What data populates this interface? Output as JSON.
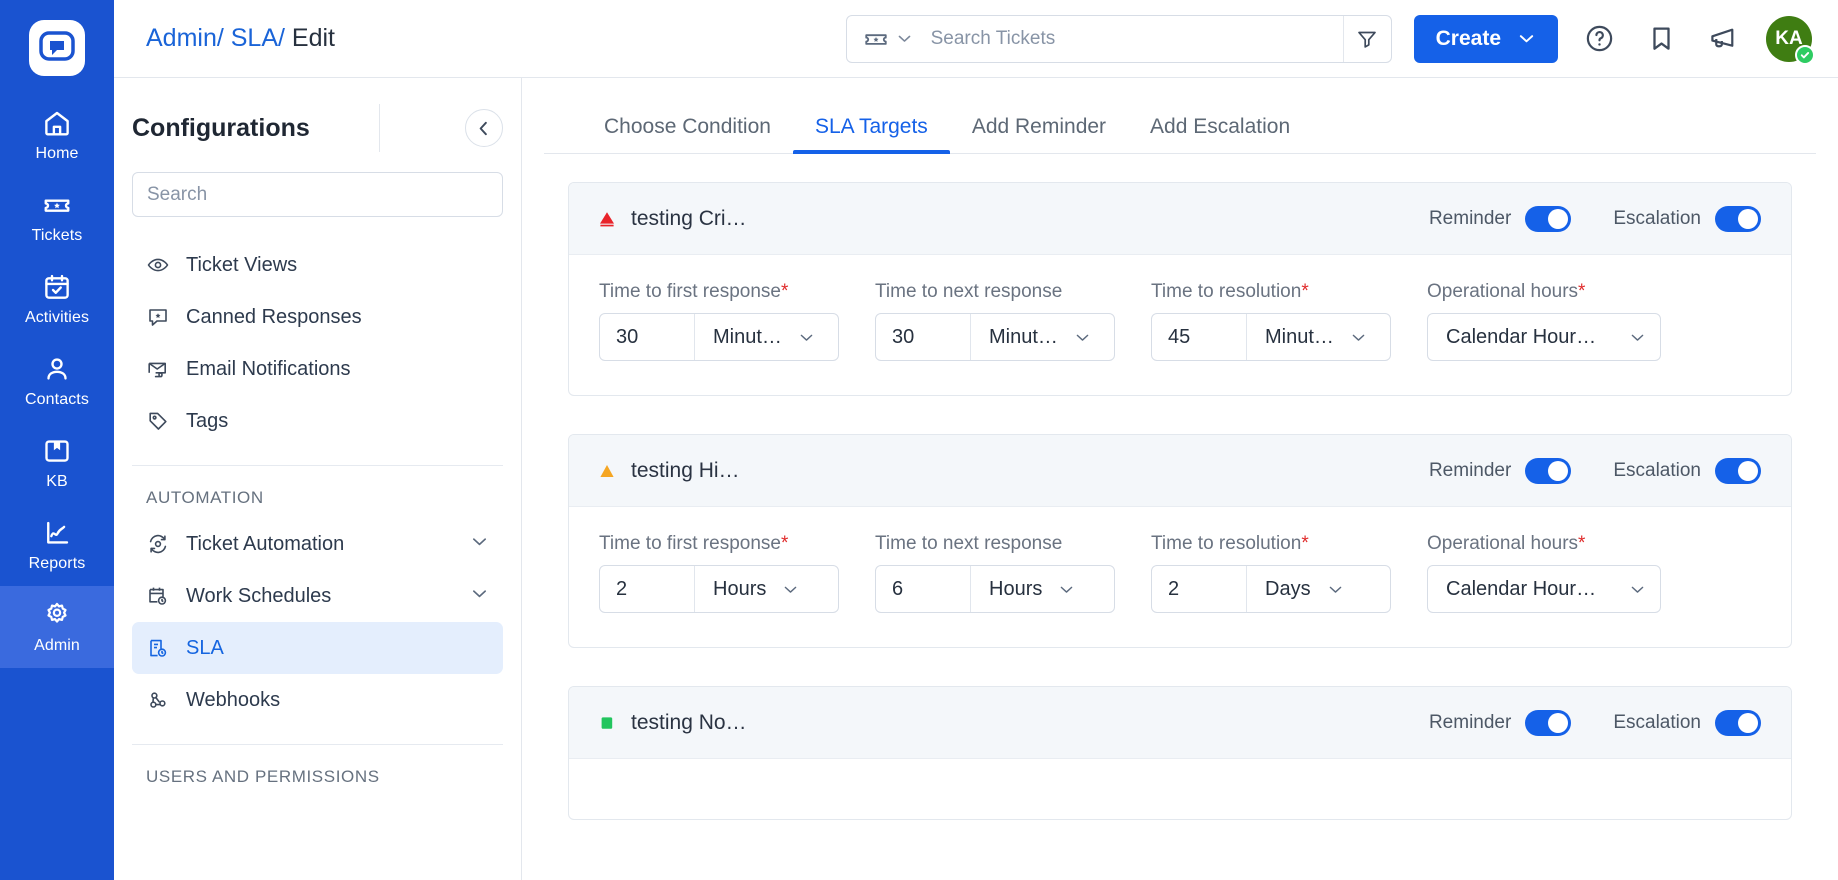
{
  "rail": {
    "logo_name": "app-logo",
    "items": [
      {
        "label": "Home",
        "icon": "home-icon",
        "active": false
      },
      {
        "label": "Tickets",
        "icon": "ticket-icon",
        "active": false
      },
      {
        "label": "Activities",
        "icon": "calendar-check-icon",
        "active": false
      },
      {
        "label": "Contacts",
        "icon": "person-icon",
        "active": false
      },
      {
        "label": "KB",
        "icon": "book-icon",
        "active": false
      },
      {
        "label": "Reports",
        "icon": "chart-icon",
        "active": false
      },
      {
        "label": "Admin",
        "icon": "gear-icon",
        "active": true
      }
    ]
  },
  "header": {
    "breadcrumb": {
      "link_part": "Admin/ SLA/",
      "current_part": " Edit"
    },
    "search": {
      "placeholder": "Search Tickets",
      "value": "",
      "type_icon": "ticket-icon"
    },
    "filter_icon": "filter-icon",
    "create_label": "Create",
    "help_icon": "help-circle-icon",
    "bookmark_icon": "bookmark-icon",
    "announcement_icon": "megaphone-icon",
    "avatar": {
      "initials": "KA",
      "color": "#3f7d12",
      "badge": "check-badge"
    }
  },
  "sidebar": {
    "title": "Configurations",
    "collapse_icon": "chevron-left-icon",
    "search_placeholder": "Search",
    "search_value": "",
    "items": [
      {
        "label": "Ticket Views",
        "icon": "eye-icon",
        "expandable": false,
        "active": false
      },
      {
        "label": "Canned Responses",
        "icon": "canned-response-icon",
        "expandable": false,
        "active": false
      },
      {
        "label": "Email Notifications",
        "icon": "email-bell-icon",
        "expandable": false,
        "active": false
      },
      {
        "label": "Tags",
        "icon": "tag-icon",
        "expandable": false,
        "active": false
      }
    ],
    "groups": [
      {
        "label": "AUTOMATION",
        "items": [
          {
            "label": "Ticket Automation",
            "icon": "automation-icon",
            "expandable": true,
            "active": false
          },
          {
            "label": "Work Schedules",
            "icon": "calendar-clock-icon",
            "expandable": true,
            "active": false
          },
          {
            "label": "SLA",
            "icon": "sla-clipboard-icon",
            "expandable": false,
            "active": true
          },
          {
            "label": "Webhooks",
            "icon": "webhook-icon",
            "expandable": false,
            "active": false
          }
        ]
      },
      {
        "label": "USERS AND PERMISSIONS",
        "items": []
      }
    ]
  },
  "main": {
    "tabs": [
      {
        "label": "Choose Condition",
        "active": false
      },
      {
        "label": "SLA Targets",
        "active": true
      },
      {
        "label": "Add Reminder",
        "active": false
      },
      {
        "label": "Add Escalation",
        "active": false
      }
    ],
    "field_labels": {
      "first_response": "Time to first response",
      "next_response": "Time to next response",
      "resolution": "Time to resolution",
      "operational_hours": "Operational hours"
    },
    "toggle_labels": {
      "reminder": "Reminder",
      "escalation": "Escalation"
    },
    "cards": [
      {
        "title": "testing Cri…",
        "priority_icon": "priority-critical-triangle",
        "priority_color": "#e8232a",
        "reminder_on": true,
        "escalation_on": true,
        "first_response": {
          "value": "30",
          "unit": "Minut…"
        },
        "next_response": {
          "value": "30",
          "unit": "Minut…"
        },
        "resolution": {
          "value": "45",
          "unit": "Minut…"
        },
        "operational_hours": "Calendar Hour…"
      },
      {
        "title": "testing Hi…",
        "priority_icon": "priority-high-triangle",
        "priority_color": "#f5a623",
        "reminder_on": true,
        "escalation_on": true,
        "first_response": {
          "value": "2",
          "unit": "Hours"
        },
        "next_response": {
          "value": "6",
          "unit": "Hours"
        },
        "resolution": {
          "value": "2",
          "unit": "Days"
        },
        "operational_hours": "Calendar Hour…"
      },
      {
        "title": "testing No…",
        "priority_icon": "priority-normal-square",
        "priority_color": "#22c55e",
        "reminder_on": true,
        "escalation_on": true,
        "first_response": {
          "value": "",
          "unit": ""
        },
        "next_response": {
          "value": "",
          "unit": ""
        },
        "resolution": {
          "value": "",
          "unit": ""
        },
        "operational_hours": ""
      }
    ]
  },
  "colors": {
    "brand": "#1561e8",
    "rail": "#1a53d0",
    "active_nav_bg": "#e4eefd"
  }
}
